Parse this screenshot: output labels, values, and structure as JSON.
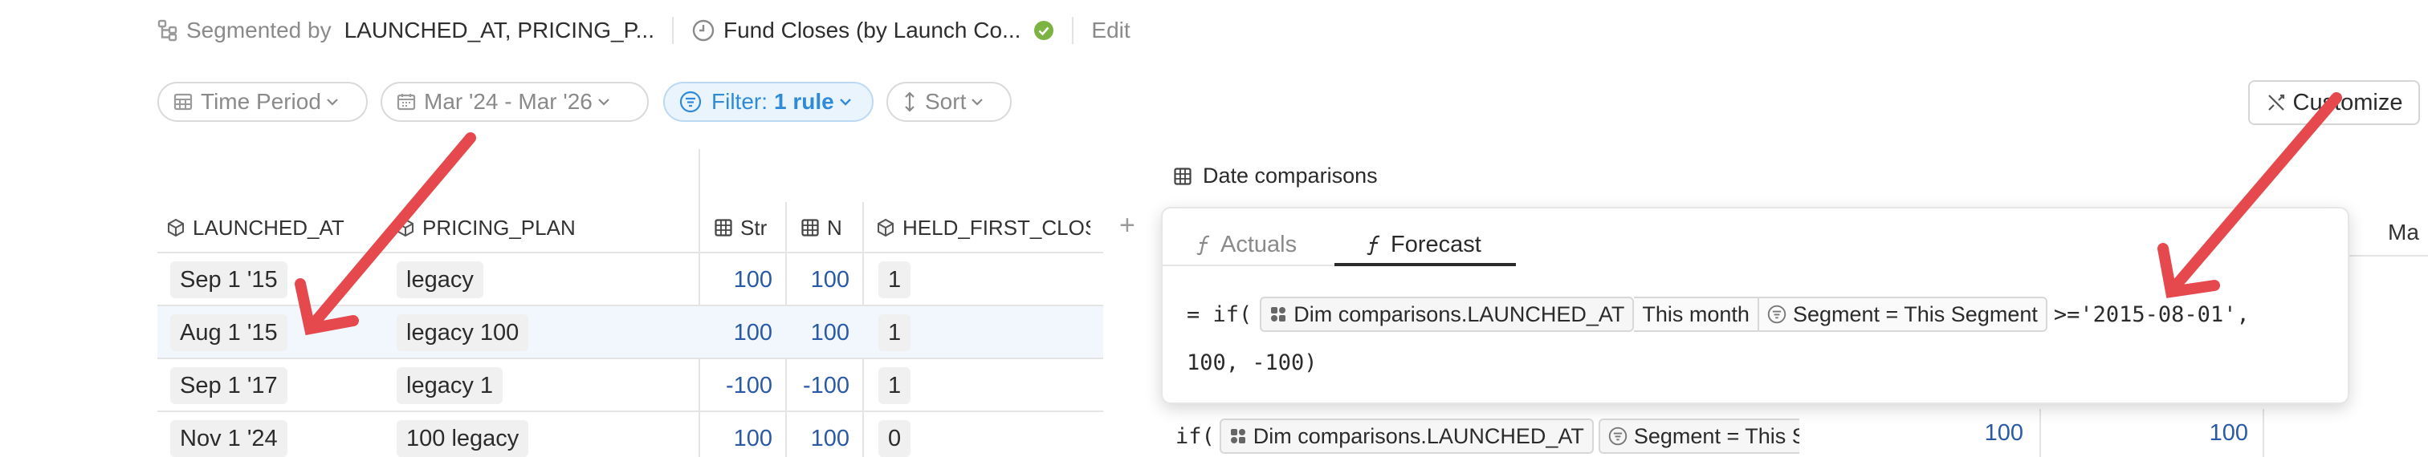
{
  "topbar": {
    "segmented_by_label": "Segmented by",
    "segmented_by_value": "LAUNCHED_AT, PRICING_P...",
    "metric_name": "Fund Closes (by Launch Co...",
    "edit_label": "Edit",
    "status_color": "#7cb342"
  },
  "filters": {
    "time_period": "Time Period",
    "date_range": "Mar '24 - Mar '26",
    "filter_label": "Filter:",
    "filter_value": "1 rule",
    "sort": "Sort",
    "customize": "Customize"
  },
  "table": {
    "columns": {
      "launched_at": "LAUNCHED_AT",
      "pricing_plan": "PRICING_PLAN",
      "str": "Str",
      "n": "N",
      "held_first_close": "HELD_FIRST_CLOS"
    },
    "add_column": "+",
    "rows": [
      {
        "launched_at": "Sep 1 '15",
        "pricing_plan": "legacy",
        "str": "100",
        "n": "100",
        "held": "1"
      },
      {
        "launched_at": "Aug 1 '15",
        "pricing_plan": "legacy 100",
        "str": "100",
        "n": "100",
        "held": "1"
      },
      {
        "launched_at": "Sep 1 '17",
        "pricing_plan": "legacy 1",
        "str": "-100",
        "n": "-100",
        "held": "1"
      },
      {
        "launched_at": "Nov 1 '24",
        "pricing_plan": "100 legacy",
        "str": "100",
        "n": "100",
        "held": "0"
      }
    ]
  },
  "date_comparisons": {
    "title": "Date comparisons",
    "next_column_label": "Ma"
  },
  "popup": {
    "tab_actuals": "Actuals",
    "tab_forecast": "Forecast",
    "formula_eq": "= if(",
    "dim_chip": "Dim comparisons.LAUNCHED_AT",
    "this_month_chip": "This month",
    "segment_chip": "Segment = This Segment",
    "formula_rest": ">='2015-08-01',",
    "formula_line2": "100, -100)"
  },
  "bottom_row": {
    "if_prefix": "if(",
    "dim_chip": "Dim comparisons.LAUNCHED_AT",
    "segment_chip": "Segment = This S",
    "value1": "100",
    "value2": "100"
  },
  "annotation_color": "#e5484d"
}
